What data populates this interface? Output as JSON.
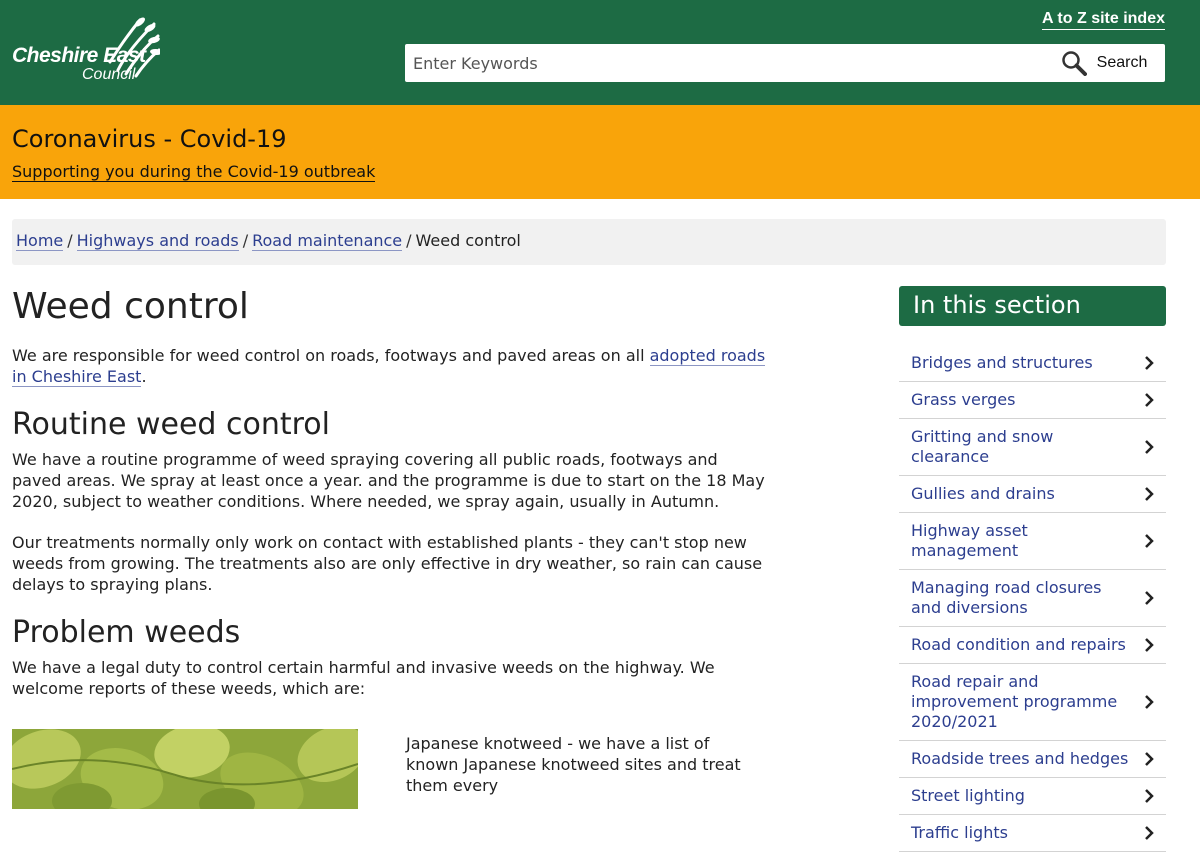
{
  "header": {
    "logo_line1": "Cheshire East",
    "logo_line2": "Council",
    "az_link": "A to Z site index",
    "search_placeholder": "Enter Keywords",
    "search_button": "Search",
    "brand_color": "#1d6b44"
  },
  "alert": {
    "title": "Coronavirus - Covid-19",
    "link": "Supporting you during the Covid-19 outbreak",
    "color": "#f9a40a"
  },
  "breadcrumb": {
    "items": [
      "Home",
      "Highways and roads",
      "Road maintenance"
    ],
    "current": "Weed control",
    "separator": "/"
  },
  "main": {
    "title": "Weed control",
    "intro_text": "We are responsible for weed control on roads, footways and paved areas on all ",
    "intro_link": "adopted roads in Cheshire East",
    "intro_end": ".",
    "section1_heading": "Routine weed control",
    "section1_p1": "We have a routine programme of weed spraying covering all public roads, footways and paved areas. We spray at least once a year. and the programme is due to start on the 18 May 2020, subject to weather conditions. Where needed, we spray again, usually in Autumn.",
    "section1_p2": "Our treatments normally only work on contact with established plants - they can't stop new weeds from growing. The treatments also are only effective in dry weather, so rain can cause delays to spraying plans.",
    "section2_heading": "Problem weeds",
    "section2_p1": "We have a legal duty to control certain harmful and invasive weeds on the highway. We welcome reports of these weeds, which are:",
    "weed_text": "Japanese knotweed - we have a list of known Japanese knotweed sites and treat them every"
  },
  "sidebar": {
    "heading": "In this section",
    "items": [
      "Bridges and structures",
      "Grass verges",
      "Gritting and snow clearance",
      "Gullies and drains",
      "Highway asset management",
      "Managing road closures and diversions",
      "Road condition and repairs",
      "Road repair and improvement programme 2020/2021",
      "Roadside trees and hedges",
      "Street lighting",
      "Traffic lights"
    ]
  }
}
